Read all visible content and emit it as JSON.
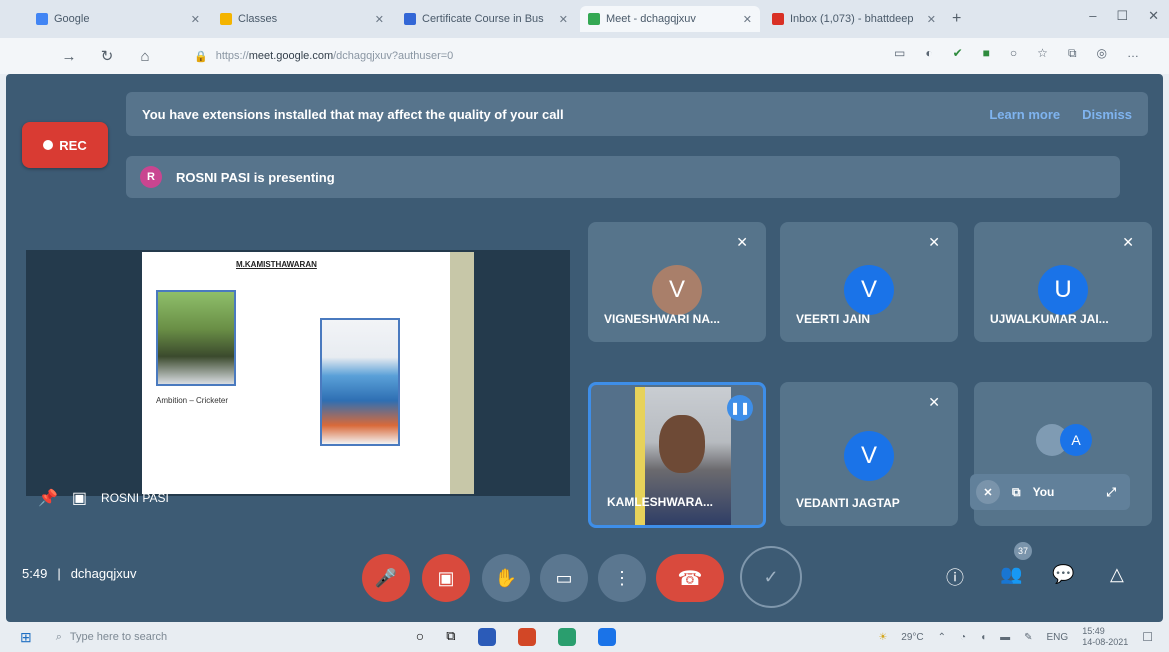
{
  "browser": {
    "tabs": [
      {
        "label": "Google",
        "color": "#4285f4"
      },
      {
        "label": "Classes",
        "color": "#f4b400"
      },
      {
        "label": "Certificate Course in Bus",
        "color": "#3367d6"
      },
      {
        "label": "Meet - dchagqjxuv",
        "color": "#34a853",
        "active": true
      },
      {
        "label": "Inbox (1,073) - bhattdeep",
        "color": "#d93025"
      }
    ],
    "url_host": "meet.google.com",
    "url_path": "/dchagqjxuv?authuser=0"
  },
  "meet": {
    "rec_label": "REC",
    "banner_text": "You have extensions installed that may affect the quality of your call",
    "banner_learn": "Learn more",
    "banner_dismiss": "Dismiss",
    "presenting_initial": "R",
    "presenting_text": "ROSNI PASI is presenting",
    "slide_title": "M.KAMISTHAWARAN",
    "slide_caption": "Ambition – Cricketer",
    "presenter_name": "ROSNI PASI",
    "tiles": [
      {
        "name": "VIGNESHWARI NA...",
        "initial": "V",
        "color": "#a97f6a"
      },
      {
        "name": "VEERTI JAIN",
        "initial": "V",
        "color": "#1a73e8"
      },
      {
        "name": "UJWALKUMAR JAI...",
        "initial": "U",
        "color": "#1a73e8"
      },
      {
        "name": "KAMLESHWARA...",
        "initial": ""
      },
      {
        "name": "VEDANTI JAGTAP",
        "initial": "V",
        "color": "#1a73e8"
      },
      {
        "name": "",
        "initial": "A",
        "color": "#1a73e8"
      }
    ],
    "you_label": "You",
    "time": "5:49",
    "meeting_code": "dchagqjxuv",
    "participant_count": "37"
  },
  "taskbar": {
    "search_placeholder": "Type here to search",
    "weather": "29°C",
    "language": "ENG",
    "clock_time": "15:49",
    "clock_date": "14-08-2021"
  }
}
